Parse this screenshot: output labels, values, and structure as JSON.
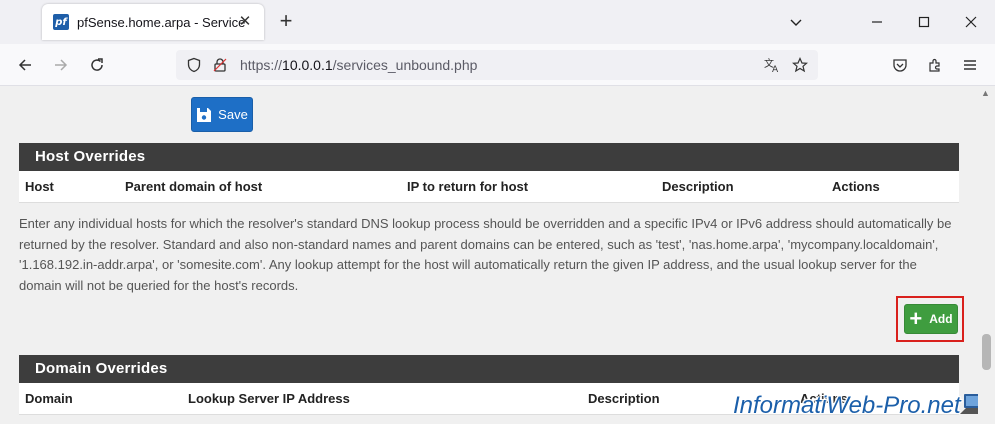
{
  "browser": {
    "tab_title": "pfSense.home.arpa - Services: D",
    "favicon_text": "pf",
    "url_prefix": "https://",
    "url_host": "10.0.0.1",
    "url_path": "/services_unbound.php"
  },
  "save_button": {
    "label": "Save"
  },
  "host_overrides": {
    "title": "Host Overrides",
    "columns": [
      "Host",
      "Parent domain of host",
      "IP to return for host",
      "Description",
      "Actions"
    ]
  },
  "info_text": "Enter any individual hosts for which the resolver's standard DNS lookup process should be overridden and a specific IPv4 or IPv6 address should automatically be returned by the resolver. Standard and also non-standard names and parent domains can be entered, such as 'test', 'nas.home.arpa', 'mycompany.localdomain', '1.168.192.in-addr.arpa', or 'somesite.com'. Any lookup attempt for the host will automatically return the given IP address, and the usual lookup server for the domain will not be queried for the host's records.",
  "add_button": {
    "label": "Add"
  },
  "domain_overrides": {
    "title": "Domain Overrides",
    "columns": [
      "Domain",
      "Lookup Server IP Address",
      "Description",
      "Actions"
    ]
  },
  "watermark": "InformatiWeb-Pro.net",
  "colors": {
    "save_blue": "#1e6fc6",
    "add_green": "#3f9d3f",
    "panel_header": "#3d3d3d",
    "highlight_red": "#d9201c"
  }
}
